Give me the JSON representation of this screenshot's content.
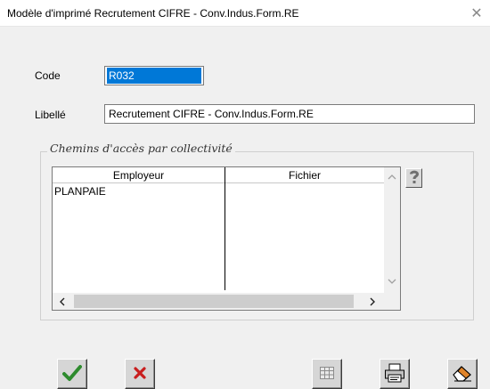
{
  "window": {
    "title": "Modèle d'imprimé Recrutement CIFRE - Conv.Indus.Form.RE",
    "close_glyph": "✕"
  },
  "form": {
    "code_label": "Code",
    "code_value": "R032",
    "libelle_label": "Libellé",
    "libelle_value": "Recrutement CIFRE - Conv.Indus.Form.RE"
  },
  "paths_group": {
    "legend": "Chemins d'accès par collectivité",
    "columns": [
      "Employeur",
      "Fichier"
    ],
    "rows": [
      {
        "employeur": "PLANPAIE",
        "fichier": ""
      }
    ]
  },
  "help_button": {
    "icon": "question-mark-icon"
  },
  "toolbar": {
    "buttons": [
      {
        "name": "validate-button",
        "icon": "checkmark-icon",
        "color": "#2e8b2e"
      },
      {
        "name": "cancel-button",
        "icon": "cross-icon",
        "color": "#c81e1e"
      },
      {
        "name": "grid-button",
        "icon": "grid-icon"
      },
      {
        "name": "print-button",
        "icon": "printer-icon"
      },
      {
        "name": "eraser-button",
        "icon": "eraser-icon"
      }
    ]
  }
}
